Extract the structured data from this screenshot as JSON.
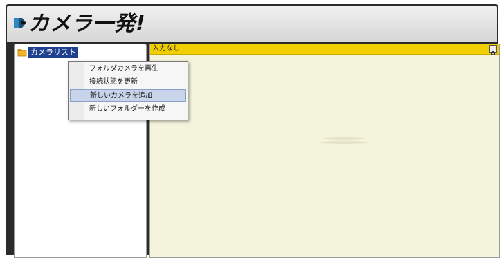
{
  "app": {
    "title": "カメラ一発!"
  },
  "tree": {
    "root_label": "カメラリスト"
  },
  "viewer": {
    "input_status": "入力なし"
  },
  "context_menu": {
    "items": [
      {
        "label": "フォルダカメラを再生"
      },
      {
        "label": "接続状態を更新"
      },
      {
        "label": "新しいカメラを追加",
        "highlighted": true
      },
      {
        "label": "新しいフォルダーを作成"
      }
    ]
  },
  "colors": {
    "title_bar": "#e3e3e3",
    "window_frame": "#2b2b2b",
    "viewer_background": "#f4f3dc",
    "input_bar": "#f2cf00",
    "selection": "#1f3f8f",
    "menu_highlight": "#c8d4ea"
  },
  "icons": {
    "logo": "camera-logo-icon",
    "tree_root": "folder-icon",
    "input_camera": "camera-icon"
  }
}
